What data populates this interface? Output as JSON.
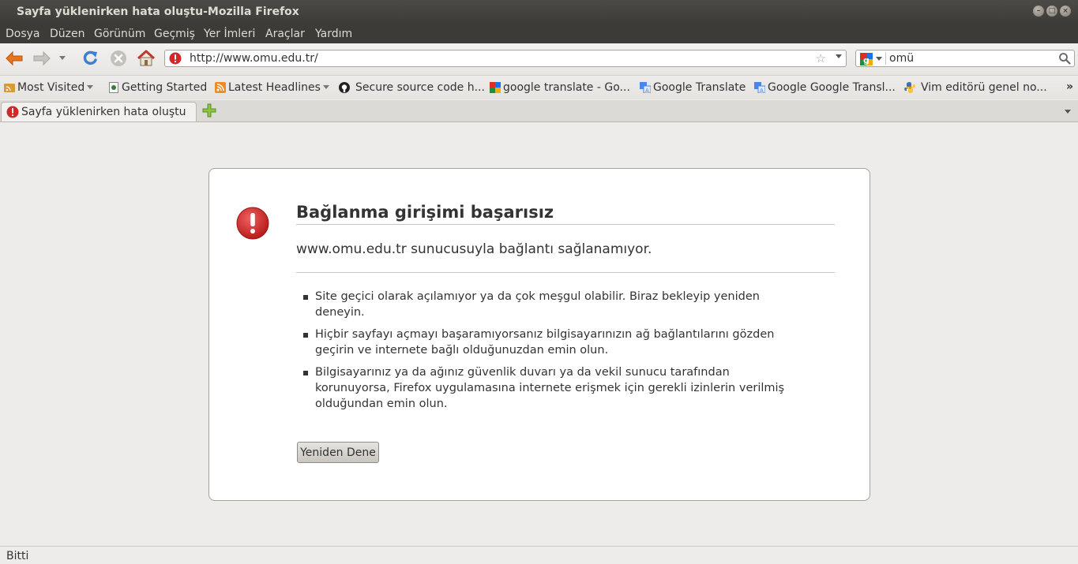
{
  "window": {
    "title": "Sayfa yüklenirken hata oluştu-Mozilla Firefox"
  },
  "menu": [
    "Dosya",
    "Düzen",
    "Görünüm",
    "Geçmiş",
    "Yer İmleri",
    "Araçlar",
    "Yardım"
  ],
  "navbar": {
    "url": "http://www.omu.edu.tr/",
    "search_query": "omü"
  },
  "bookmarks": [
    {
      "label": "Most Visited",
      "icon": "rss-folder-icon",
      "dropdown": true
    },
    {
      "label": "Getting Started",
      "icon": "page-icon",
      "dropdown": false
    },
    {
      "label": "Latest Headlines",
      "icon": "rss-icon",
      "dropdown": true
    },
    {
      "label": "Secure source code h...",
      "icon": "github-icon",
      "dropdown": false
    },
    {
      "label": "google translate - Go...",
      "icon": "google-icon",
      "dropdown": false
    },
    {
      "label": "Google Translate",
      "icon": "translate-icon",
      "dropdown": false
    },
    {
      "label": "Google Google Transl...",
      "icon": "translate-icon",
      "dropdown": false
    },
    {
      "label": "Vim editörü genel no...",
      "icon": "python-icon",
      "dropdown": false
    }
  ],
  "tab": {
    "label": "Sayfa yüklenirken hata oluştu"
  },
  "error": {
    "title": "Bağlanma girişimi başarısız",
    "description": "www.omu.edu.tr sunucusuyla bağlantı sağlanamıyor.",
    "items": [
      "Site geçici olarak açılamıyor ya da çok meşgul olabilir. Biraz bekleyip yeniden deneyin.",
      "Hiçbir sayfayı açmayı başaramıyorsanız bilgisayarınızın ağ bağlantılarını gözden geçirin ve internete bağlı olduğunuzdan emin olun.",
      "Bilgisayarınız ya da ağınız güvenlik duvarı ya da vekil sunucu tarafından korunuyorsa, Firefox uygulamasına internete erişmek için gerekli izinlerin verilmiş olduğundan emin olun."
    ],
    "retry_label": "Yeniden Dene"
  },
  "status": {
    "text": "Bitti"
  },
  "colors": {
    "titlebar": "#3c3b37",
    "error_red": "#d12929",
    "back_arrow": "#e8741b",
    "reload_blue": "#3d7fd1"
  }
}
